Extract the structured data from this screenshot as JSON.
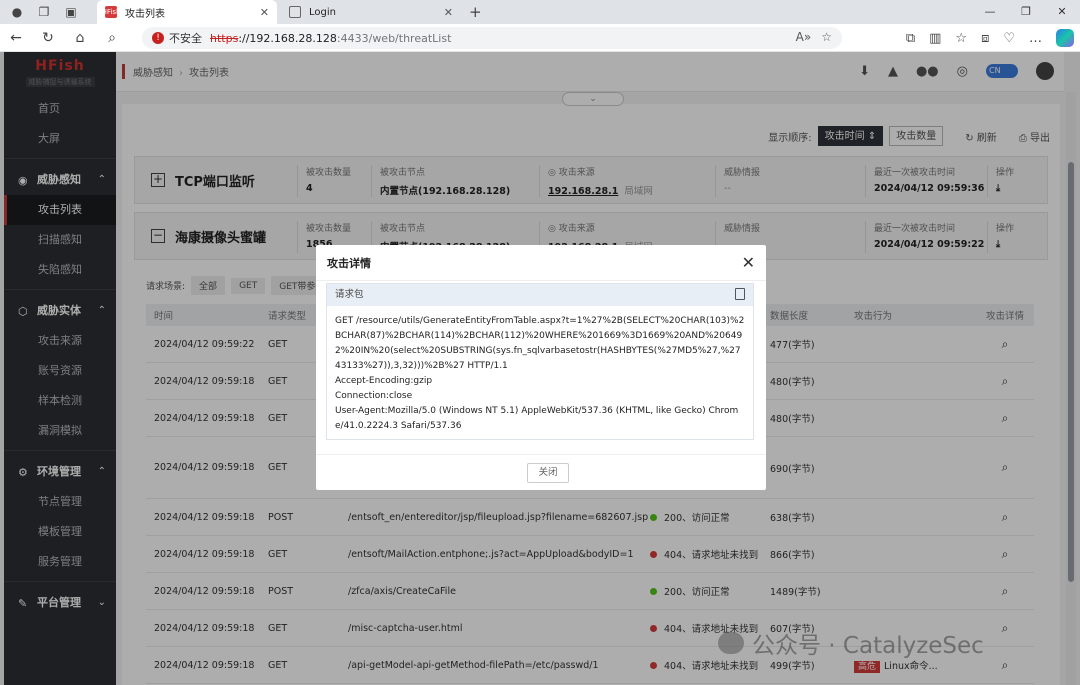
{
  "browser": {
    "tabs": [
      {
        "title": "攻击列表",
        "favicon_text": "HFish"
      },
      {
        "title": "Login"
      }
    ],
    "address": {
      "warning": "不安全",
      "scheme": "https",
      "host": "://192.168.28.128",
      "rest": ":4433/web/threatList"
    }
  },
  "sidebar": {
    "brand": "HFish",
    "brand_sub": "威胁捕捉与诱骗系统",
    "top_items": [
      "首页",
      "大屏"
    ],
    "groups": [
      {
        "label": "威胁感知",
        "items": [
          "攻击列表",
          "扫描感知",
          "失陷感知"
        ]
      },
      {
        "label": "威胁实体",
        "items": [
          "攻击来源",
          "账号资源",
          "样本检测",
          "漏洞模拟"
        ]
      },
      {
        "label": "环境管理",
        "items": [
          "节点管理",
          "模板管理",
          "服务管理"
        ]
      },
      {
        "label": "平台管理",
        "items": []
      }
    ]
  },
  "topbar": {
    "breadcrumb": [
      "威胁感知",
      "攻击列表"
    ],
    "lang": "CN"
  },
  "toolbar": {
    "sort_label": "显示顺序:",
    "sort_time": "攻击时间",
    "sort_count": "攻击数量",
    "refresh": "刷新",
    "export": "导出"
  },
  "groups": [
    {
      "toggle": "+",
      "title": "TCP端口监听",
      "count_label": "被攻击数量",
      "count": "4",
      "node_label": "被攻击节点",
      "node": "内置节点(192.168.28.128)",
      "source_label": "攻击来源",
      "source": "192.168.28.1",
      "source_sub": "局域网",
      "intel_label": "威胁情报",
      "intel": "--",
      "last_label": "最近一次被攻击时间",
      "last": "2024/04/12 09:59:36",
      "op_label": "操作"
    },
    {
      "toggle": "−",
      "title": "海康摄像头蜜罐",
      "count_label": "被攻击数量",
      "count": "1856",
      "node_label": "被攻击节点",
      "node": "内置节点(192.168.28.128)",
      "source_label": "攻击来源",
      "source": "192.168.28.1",
      "source_sub": "局域网",
      "intel_label": "威胁情报",
      "intel": "",
      "last_label": "最近一次被攻击时间",
      "last": "2024/04/12 09:59:22",
      "op_label": "操作"
    }
  ],
  "filter": {
    "label": "请求场景:",
    "buttons": [
      "全部",
      "GET",
      "GET带参数"
    ]
  },
  "table": {
    "headers": [
      "时间",
      "请求类型",
      "",
      "",
      "数据长度",
      "攻击行为",
      "攻击详情"
    ],
    "rows": [
      {
        "time": "2024/04/12 09:59:22",
        "method": "GET",
        "path": "",
        "status": "",
        "status_color": "",
        "length": "477(字节)",
        "behavior": "",
        "tag": ""
      },
      {
        "time": "2024/04/12 09:59:18",
        "method": "GET",
        "path": "",
        "status": "",
        "status_color": "",
        "length": "480(字节)",
        "behavior": "",
        "tag": ""
      },
      {
        "time": "2024/04/12 09:59:18",
        "method": "GET",
        "path": "",
        "status": "",
        "status_color": "",
        "length": "480(字节)",
        "behavior": "",
        "tag": ""
      },
      {
        "time": "2024/04/12 09:59:18",
        "method": "GET",
        "path": "43133%27)),3,32)))%2B%27",
        "status": "",
        "status_color": "",
        "length": "690(字节)",
        "behavior": "",
        "tag": ""
      },
      {
        "time": "2024/04/12 09:59:18",
        "method": "POST",
        "path": "/entsoft_en/entereditor/jsp/fileupload.jsp?filename=682607.jsp",
        "status": "200、访问正常",
        "status_color": "#52c41a",
        "length": "638(字节)",
        "behavior": "",
        "tag": ""
      },
      {
        "time": "2024/04/12 09:59:18",
        "method": "GET",
        "path": "/entsoft/MailAction.entphone;.js?act=AppUpload&bodyID=1",
        "status": "404、请求地址未找到",
        "status_color": "#d63b3b",
        "length": "866(字节)",
        "behavior": "",
        "tag": ""
      },
      {
        "time": "2024/04/12 09:59:18",
        "method": "POST",
        "path": "/zfca/axis/CreateCaFile",
        "status": "200、访问正常",
        "status_color": "#52c41a",
        "length": "1489(字节)",
        "behavior": "",
        "tag": ""
      },
      {
        "time": "2024/04/12 09:59:18",
        "method": "GET",
        "path": "/misc-captcha-user.html",
        "status": "404、请求地址未找到",
        "status_color": "#d63b3b",
        "length": "607(字节)",
        "behavior": "",
        "tag": ""
      },
      {
        "time": "2024/04/12 09:59:18",
        "method": "GET",
        "path": "/api-getModel-api-getMethod-filePath=/etc/passwd/1",
        "status": "404、请求地址未找到",
        "status_color": "#d63b3b",
        "length": "499(字节)",
        "behavior": "Linux命令...",
        "tag": "高危"
      }
    ]
  },
  "modal": {
    "title": "攻击详情",
    "section": "请求包",
    "lines": [
      "GET /resource/utils/GenerateEntityFromTable.aspx?t=1%27%2B(SELECT%20CHAR(103)%2BCHAR(87)%2BCHAR(114)%2BCHAR(112)%20WHERE%201669%3D1669%20AND%206492%20IN%20(select%20SUBSTRING(sys.fn_sqlvarbasetostr(HASHBYTES(%27MD5%27,%2743133%27)),3,32)))%2B%27 HTTP/1.1",
      "Accept-Encoding:gzip",
      "Connection:close",
      "User-Agent:Mozilla/5.0 (Windows NT 5.1) AppleWebKit/537.36 (KHTML, like Gecko) Chrome/41.0.2224.3 Safari/537.36"
    ],
    "close": "关闭"
  },
  "watermark": "公众号 · CatalyzeSec"
}
